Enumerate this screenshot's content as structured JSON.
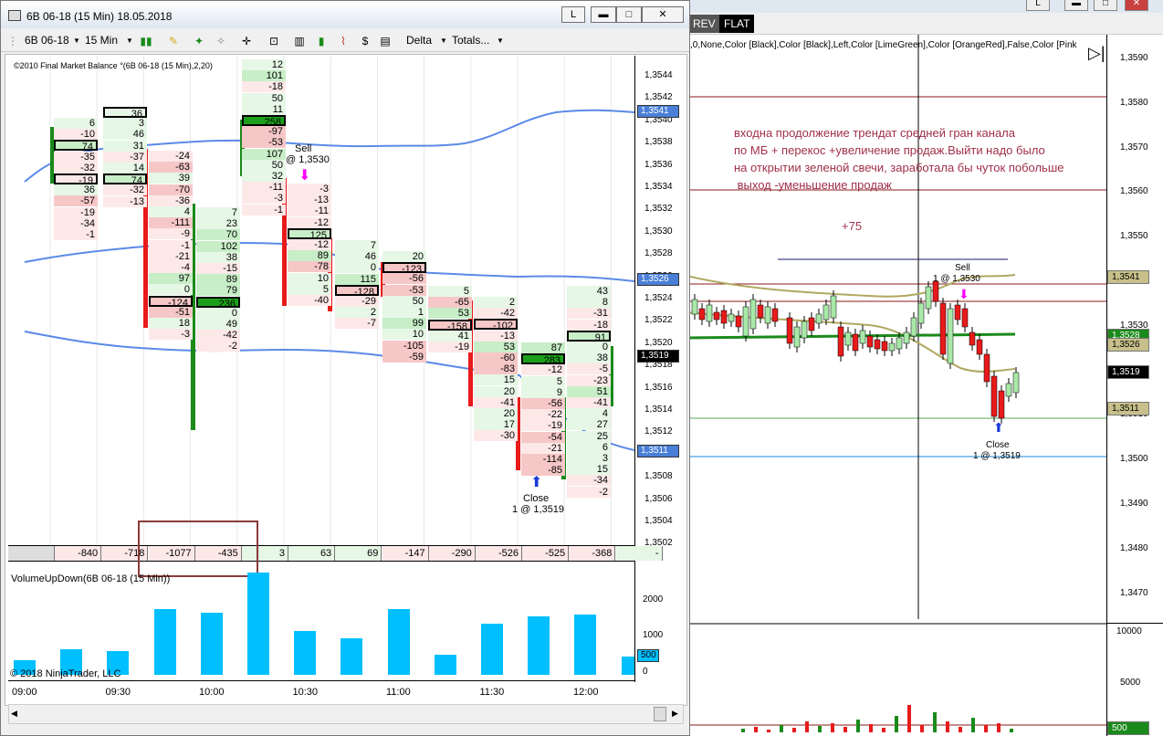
{
  "window": {
    "title": "6B 06-18 (15 Min)  18.05.2018",
    "btn_l": "L",
    "btn_min": "▬",
    "btn_max": "□",
    "btn_close": "✕"
  },
  "toolbar": {
    "instrument": "6B 06-18",
    "interval": "15 Min",
    "delta": "Delta",
    "totals": "Totals..."
  },
  "chart": {
    "indicator_label": "©2010 Final Market Balance  °(6B 06-18 (15 Min),2,20)",
    "pane_flag": "F",
    "sell_label": "Sell",
    "sell_detail": "@ 1,3530",
    "close_label": "Close",
    "close_detail": "1 @ 1,3519",
    "price_ticks": [
      "1,3544",
      "1,3542",
      "1,3540",
      "1,3538",
      "1,3536",
      "1,3534",
      "1,3532",
      "1,3530",
      "1,3528",
      "1,3526",
      "1,3524",
      "1,3522",
      "1,3520",
      "1,3518",
      "1,3516",
      "1,3514",
      "1,3512",
      "1,3510",
      "1,3508",
      "1,3506",
      "1,3504",
      "1,3502"
    ],
    "price_labels": [
      {
        "text": "1,3541",
        "color": "#4a7fd8"
      },
      {
        "text": "1,3526",
        "color": "#4a7fd8"
      },
      {
        "text": "1,3519",
        "color": "#000000"
      },
      {
        "text": "1,3511",
        "color": "#4a7fd8"
      }
    ],
    "totals": [
      "",
      "-840",
      "-718",
      "-1077",
      "-435",
      "3",
      "63",
      "69",
      "-147",
      "-290",
      "-526",
      "-525",
      "-368",
      "-"
    ],
    "volume_title": "VolumeUpDown(6B 06-18 (15 Min))",
    "volume_ticks": [
      "2000",
      "1000",
      "0"
    ],
    "volume_label": "500",
    "volume_values": [
      400,
      700,
      650,
      1800,
      1700,
      2800,
      1200,
      1000,
      1800,
      550,
      1400,
      1600,
      1650,
      500
    ],
    "copyright": "© 2018 NinjaTrader, LLC",
    "time_labels": [
      "09:00",
      "09:30",
      "10:00",
      "10:30",
      "11:00",
      "11:30",
      "12:00"
    ]
  },
  "background": {
    "btn_rev": "REV",
    "btn_flat": "FLAT",
    "params": ",0,None,Color [Black],Color [Black],Left,Color [LimeGreen],Color [OrangeRed],False,Color [Pink",
    "note": "входна продолжение трендат средней гран канала\nпо МБ + перекос +увеличение продаж.Выйти надо было\nна открытии зеленой свечи, заработала бы чуток побольше\n выход -уменьшение продаж",
    "plus": "+75",
    "sell_label": "Sell",
    "sell_detail": "1 @ 1,3530",
    "close_label": "Close",
    "close_detail": "1 @ 1,3519",
    "small_1": "1",
    "price_ticks": [
      "1,3590",
      "1,3580",
      "1,3570",
      "1,3560",
      "1,3550",
      "1,3540",
      "1,3530",
      "1,3520",
      "1,3510",
      "1,3500",
      "1,3490",
      "1,3480",
      "1,3470"
    ],
    "price_labels": [
      {
        "text": "1,3541",
        "color": "#c8c08a"
      },
      {
        "text": "1,3528",
        "color": "#1a8a1a"
      },
      {
        "text": "1,3526",
        "color": "#c8c08a"
      },
      {
        "text": "1,3519",
        "color": "#000000"
      },
      {
        "text": "1,3511",
        "color": "#c8c08a"
      }
    ],
    "volume_ticks": [
      "10000",
      "5000"
    ],
    "volume_label": "500"
  }
}
